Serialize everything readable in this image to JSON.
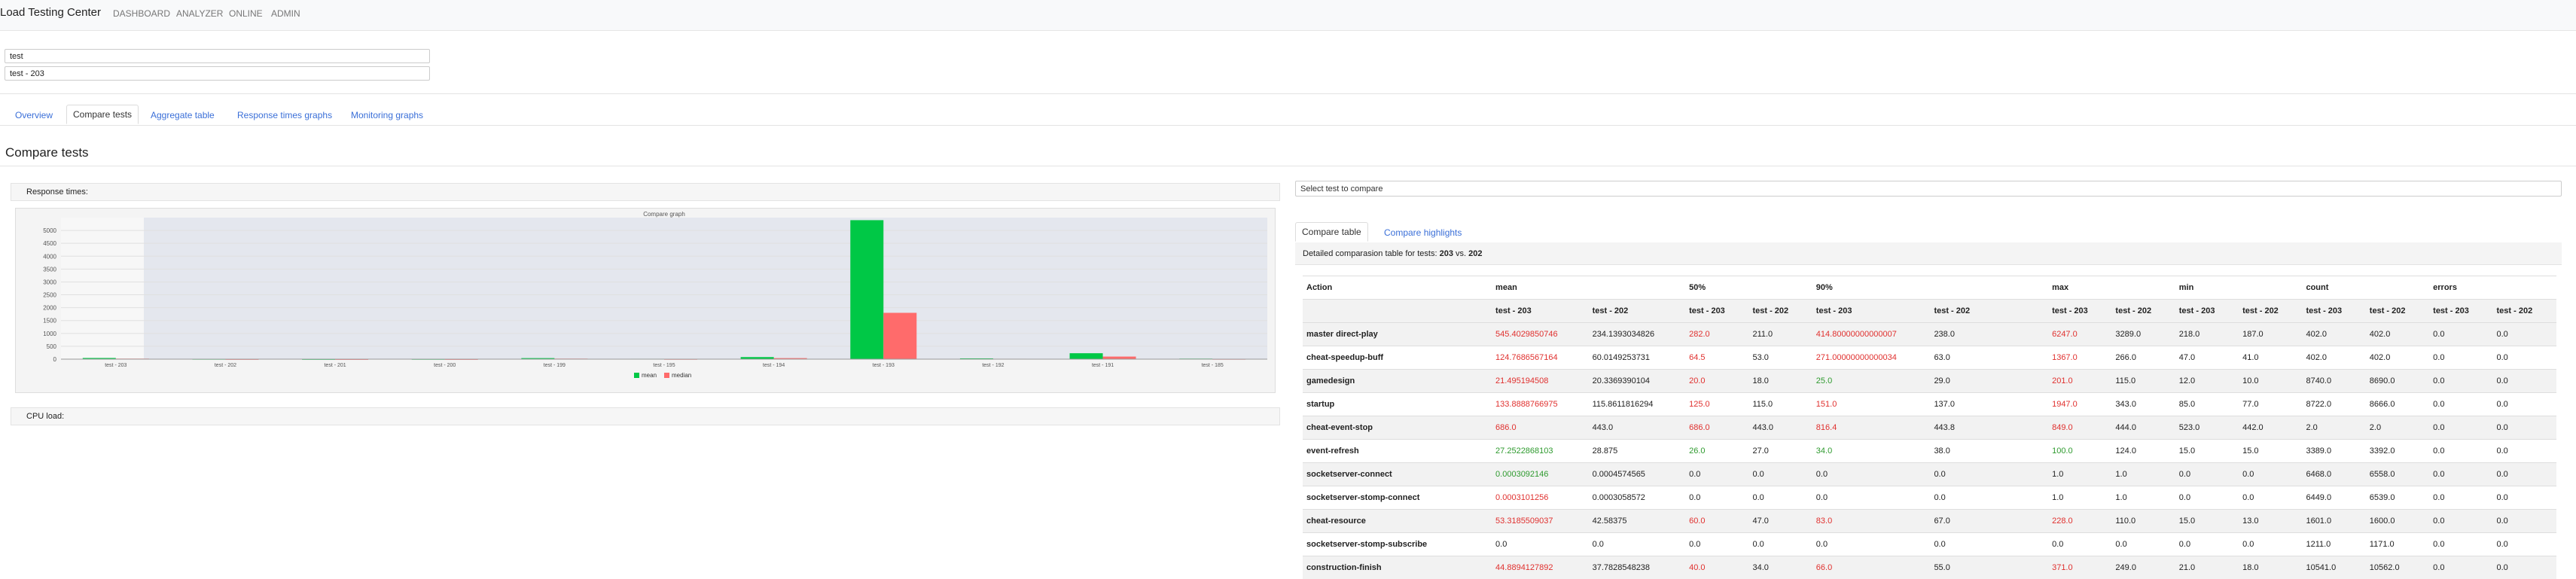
{
  "navbar": {
    "brand": "Load Testing Center",
    "links": [
      "DASHBOARD",
      "ANALYZER",
      "ONLINE",
      "ADMIN"
    ]
  },
  "filters": {
    "project": "test",
    "test": "test - 203"
  },
  "tabs": [
    "Overview",
    "Compare tests",
    "Aggregate table",
    "Response times graphs",
    "Monitoring graphs"
  ],
  "page_title": "Compare tests",
  "left": {
    "response_times_label": "Response times:",
    "cpu_load_label": "CPU load:"
  },
  "chart_data": {
    "type": "bar",
    "title": "Compare graph",
    "categories": [
      "test - 203",
      "test - 202",
      "test - 201",
      "test - 200",
      "test - 199",
      "test - 195",
      "test - 194",
      "test - 193",
      "test - 192",
      "test - 191",
      "test - 185"
    ],
    "series": [
      {
        "name": "mean",
        "color": "#00c846",
        "values": [
          45,
          10,
          5,
          8,
          40,
          15,
          80,
          5400,
          30,
          230,
          20
        ]
      },
      {
        "name": "median",
        "color": "#ff6b6b",
        "values": [
          20,
          5,
          3,
          4,
          20,
          8,
          40,
          1800,
          15,
          100,
          10
        ]
      }
    ],
    "y_ticks": [
      "0",
      "500",
      "1000",
      "1500",
      "2000",
      "2500",
      "3000",
      "3500",
      "4000",
      "4500",
      "5000"
    ],
    "ylim": [
      0,
      5500
    ],
    "legend_position": "bottom"
  },
  "right": {
    "select_placeholder": "Select test to compare",
    "tabs": [
      "Compare table",
      "Compare highlights"
    ],
    "desc_prefix": "Detailed comparasion table for tests: ",
    "desc_a": "203",
    "desc_vs": " vs. ",
    "desc_b": "202"
  },
  "table": {
    "group_headers": [
      "Action",
      "mean",
      "50%",
      "90%",
      "max",
      "min",
      "count",
      "errors"
    ],
    "sub_headers": [
      "test - 203",
      "test - 202",
      "test - 203",
      "test - 202",
      "test - 203",
      "test - 202",
      "test - 203",
      "test - 202",
      "test - 203",
      "test - 202",
      "test - 203",
      "test - 202",
      "test - 203",
      "test - 202"
    ],
    "rows": [
      {
        "action": "master direct-play",
        "cells": [
          "545.4029850746",
          "234.1393034826",
          "282.0",
          "211.0",
          "414.80000000000007",
          "238.0",
          "6247.0",
          "3289.0",
          "218.0",
          "187.0",
          "402.0",
          "402.0",
          "0.0",
          "0.0"
        ],
        "status": [
          "red",
          "",
          "red",
          "",
          "red",
          "",
          "red",
          "",
          "",
          "",
          "",
          "",
          "",
          ""
        ]
      },
      {
        "action": "cheat-speedup-buff",
        "cells": [
          "124.7686567164",
          "60.0149253731",
          "64.5",
          "53.0",
          "271.00000000000034",
          "63.0",
          "1367.0",
          "266.0",
          "47.0",
          "41.0",
          "402.0",
          "402.0",
          "0.0",
          "0.0"
        ],
        "status": [
          "red",
          "",
          "red",
          "",
          "red",
          "",
          "red",
          "",
          "",
          "",
          "",
          "",
          "",
          ""
        ]
      },
      {
        "action": "gamedesign",
        "cells": [
          "21.495194508",
          "20.3369390104",
          "20.0",
          "18.0",
          "25.0",
          "29.0",
          "201.0",
          "115.0",
          "12.0",
          "10.0",
          "8740.0",
          "8690.0",
          "0.0",
          "0.0"
        ],
        "status": [
          "red",
          "",
          "red",
          "",
          "green",
          "",
          "red",
          "",
          "",
          "",
          "",
          "",
          "",
          ""
        ]
      },
      {
        "action": "startup",
        "cells": [
          "133.8888766975",
          "115.8611816294",
          "125.0",
          "115.0",
          "151.0",
          "137.0",
          "1947.0",
          "343.0",
          "85.0",
          "77.0",
          "8722.0",
          "8666.0",
          "0.0",
          "0.0"
        ],
        "status": [
          "red",
          "",
          "red",
          "",
          "red",
          "",
          "red",
          "",
          "",
          "",
          "",
          "",
          "",
          ""
        ]
      },
      {
        "action": "cheat-event-stop",
        "cells": [
          "686.0",
          "443.0",
          "686.0",
          "443.0",
          "816.4",
          "443.8",
          "849.0",
          "444.0",
          "523.0",
          "442.0",
          "2.0",
          "2.0",
          "0.0",
          "0.0"
        ],
        "status": [
          "red",
          "",
          "red",
          "",
          "red",
          "",
          "red",
          "",
          "",
          "",
          "",
          "",
          "",
          ""
        ]
      },
      {
        "action": "event-refresh",
        "cells": [
          "27.2522868103",
          "28.875",
          "26.0",
          "27.0",
          "34.0",
          "38.0",
          "100.0",
          "124.0",
          "15.0",
          "15.0",
          "3389.0",
          "3392.0",
          "0.0",
          "0.0"
        ],
        "status": [
          "green",
          "",
          "green",
          "",
          "green",
          "",
          "green",
          "",
          "",
          "",
          "",
          "",
          "",
          ""
        ]
      },
      {
        "action": "socketserver-connect",
        "cells": [
          "0.0003092146",
          "0.0004574565",
          "0.0",
          "0.0",
          "0.0",
          "0.0",
          "1.0",
          "1.0",
          "0.0",
          "0.0",
          "6468.0",
          "6558.0",
          "0.0",
          "0.0"
        ],
        "status": [
          "green",
          "",
          "",
          "",
          "",
          "",
          "",
          "",
          "",
          "",
          "",
          "",
          "",
          ""
        ]
      },
      {
        "action": "socketserver-stomp-connect",
        "cells": [
          "0.0003101256",
          "0.0003058572",
          "0.0",
          "0.0",
          "0.0",
          "0.0",
          "1.0",
          "1.0",
          "0.0",
          "0.0",
          "6449.0",
          "6539.0",
          "0.0",
          "0.0"
        ],
        "status": [
          "red",
          "",
          "",
          "",
          "",
          "",
          "",
          "",
          "",
          "",
          "",
          "",
          "",
          ""
        ]
      },
      {
        "action": "cheat-resource",
        "cells": [
          "53.3185509037",
          "42.58375",
          "60.0",
          "47.0",
          "83.0",
          "67.0",
          "228.0",
          "110.0",
          "15.0",
          "13.0",
          "1601.0",
          "1600.0",
          "0.0",
          "0.0"
        ],
        "status": [
          "red",
          "",
          "red",
          "",
          "red",
          "",
          "red",
          "",
          "",
          "",
          "",
          "",
          "",
          ""
        ]
      },
      {
        "action": "socketserver-stomp-subscribe",
        "cells": [
          "0.0",
          "0.0",
          "0.0",
          "0.0",
          "0.0",
          "0.0",
          "0.0",
          "0.0",
          "0.0",
          "0.0",
          "1211.0",
          "1171.0",
          "0.0",
          "0.0"
        ],
        "status": [
          "",
          "",
          "",
          "",
          "",
          "",
          "",
          "",
          "",
          "",
          "",
          "",
          "",
          ""
        ]
      },
      {
        "action": "construction-finish",
        "cells": [
          "44.8894127892",
          "37.7828548238",
          "40.0",
          "34.0",
          "66.0",
          "55.0",
          "371.0",
          "249.0",
          "21.0",
          "18.0",
          "10541.0",
          "10562.0",
          "0.0",
          "0.0"
        ],
        "status": [
          "red",
          "",
          "red",
          "",
          "red",
          "",
          "red",
          "",
          "",
          "",
          "",
          "",
          "",
          ""
        ]
      }
    ]
  }
}
